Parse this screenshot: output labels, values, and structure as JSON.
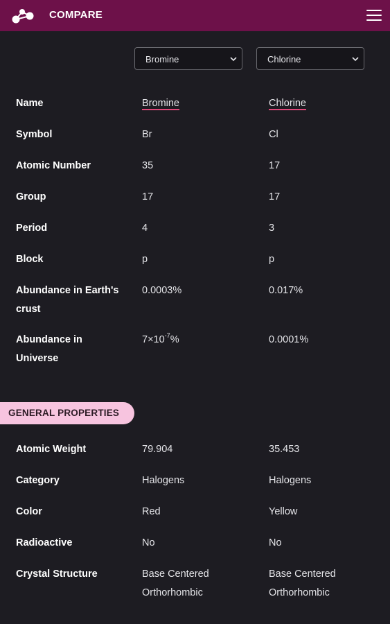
{
  "header": {
    "title": "COMPARE",
    "logo_icon": "molecule-icon",
    "menu_icon": "hamburger-menu-icon"
  },
  "selectors": [
    {
      "value": "Bromine"
    },
    {
      "value": "Chlorine"
    }
  ],
  "overview": [
    {
      "label": "Name",
      "v1": "Bromine",
      "v2": "Chlorine"
    },
    {
      "label": "Symbol",
      "v1": "Br",
      "v2": "Cl"
    },
    {
      "label": "Atomic Number",
      "v1": "35",
      "v2": "17"
    },
    {
      "label": "Group",
      "v1": "17",
      "v2": "17"
    },
    {
      "label": "Period",
      "v1": "4",
      "v2": "3"
    },
    {
      "label": "Block",
      "v1": "p",
      "v2": "p"
    },
    {
      "label": "Abundance in Earth's crust",
      "v1": "0.0003%",
      "v2": "0.017%"
    },
    {
      "label": "Abundance in Universe",
      "v1_base": "7×10",
      "v1_exp": "-7",
      "v1_unit": "%",
      "v2": "0.0001%"
    }
  ],
  "general": {
    "heading": "GENERAL PROPERTIES",
    "rows": [
      {
        "label": "Atomic Weight",
        "v1": "79.904",
        "v2": "35.453"
      },
      {
        "label": "Category",
        "v1": "Halogens",
        "v2": "Halogens"
      },
      {
        "label": "Color",
        "v1": "Red",
        "v2": "Yellow"
      },
      {
        "label": "Radioactive",
        "v1": "No",
        "v2": "No"
      },
      {
        "label": "Crystal Structure",
        "v1": "Base Centered Orthorhombic",
        "v2": "Base Centered Orthorhombic"
      }
    ]
  },
  "colors": {
    "header": "#6d1149",
    "background": "#1d1c22",
    "accent": "#e0487a",
    "pill": "#f7c4df"
  }
}
